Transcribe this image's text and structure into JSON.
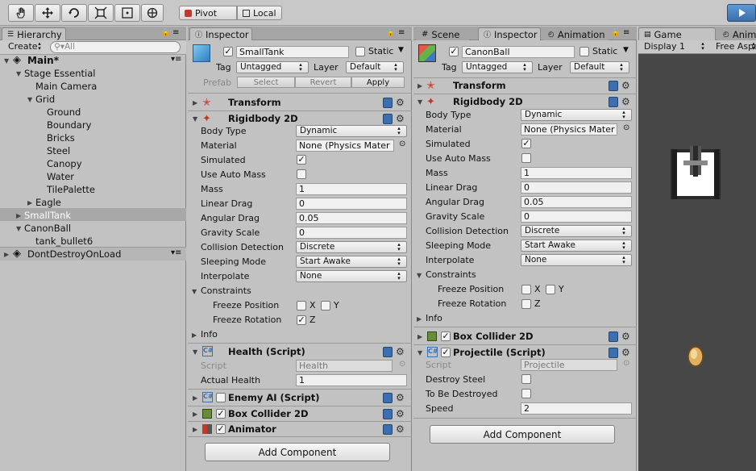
{
  "toolbar": {
    "pivot": "Pivot",
    "local": "Local"
  },
  "hierarchy": {
    "tab": "Hierarchy",
    "create": "Create",
    "search_placeholder": "All",
    "scene": "Main*",
    "items": [
      "Stage Essential",
      "Main Camera",
      "Grid",
      "Ground",
      "Boundary",
      "Bricks",
      "Steel",
      "Canopy",
      "Water",
      "TilePalette",
      "Eagle",
      "SmallTank",
      "CanonBall",
      "tank_bullet6",
      "DontDestroyOnLoad"
    ]
  },
  "inspector1": {
    "tab": "Inspector",
    "name": "SmallTank",
    "static": "Static",
    "tag_label": "Tag",
    "tag": "Untagged",
    "layer_label": "Layer",
    "layer": "Default",
    "prefab": "Prefab",
    "select": "Select",
    "revert": "Revert",
    "apply": "Apply",
    "transform": "Transform",
    "rigidbody": "Rigidbody 2D",
    "props": {
      "body_type": "Body Type",
      "material": "Material",
      "simulated": "Simulated",
      "use_auto_mass": "Use Auto Mass",
      "mass": "Mass",
      "linear_drag": "Linear Drag",
      "angular_drag": "Angular Drag",
      "gravity_scale": "Gravity Scale",
      "collision_detection": "Collision Detection",
      "sleeping_mode": "Sleeping Mode",
      "interpolate": "Interpolate",
      "constraints": "Constraints",
      "freeze_position": "Freeze Position",
      "freeze_rotation": "Freeze Rotation",
      "info": "Info"
    },
    "values": {
      "body_type": "Dynamic",
      "material": "None (Physics Mater",
      "mass": "1",
      "linear_drag": "0",
      "angular_drag": "0.05",
      "gravity_scale": "0",
      "collision_detection": "Discrete",
      "sleeping_mode": "Start Awake",
      "interpolate": "None",
      "x": "X",
      "y": "Y",
      "z": "Z"
    },
    "health": "Health (Script)",
    "script_label": "Script",
    "script_value": "Health",
    "actual_health_label": "Actual Health",
    "actual_health": "1",
    "enemy_ai": "Enemy AI (Script)",
    "box_collider": "Box Collider 2D",
    "animator": "Animator",
    "add_component": "Add Component"
  },
  "inspector2": {
    "tab_scene": "Scene",
    "tab": "Inspector",
    "tab_animation": "Animation",
    "name": "CanonBall",
    "static": "Static",
    "tag_label": "Tag",
    "tag": "Untagged",
    "layer_label": "Layer",
    "layer": "Default",
    "transform": "Transform",
    "rigidbody": "Rigidbody 2D",
    "values": {
      "body_type": "Dynamic",
      "material": "None (Physics Mater",
      "mass": "1",
      "linear_drag": "0",
      "angular_drag": "0.05",
      "gravity_scale": "0",
      "collision_detection": "Discrete",
      "sleeping_mode": "Start Awake",
      "interpolate": "None"
    },
    "box_collider": "Box Collider 2D",
    "projectile": "Projectile (Script)",
    "script_value": "Projectile",
    "destroy_steel": "Destroy Steel",
    "to_be_destroyed": "To Be Destroyed",
    "speed_label": "Speed",
    "speed": "2",
    "add_component": "Add Component"
  },
  "game": {
    "tab": "Game",
    "tab2": "Anim",
    "display": "Display 1",
    "aspect": "Free Aspe"
  },
  "colors": {
    "accent": "#3d6ea8",
    "selected_row": "#a8a8a8",
    "game_bg": "#474747"
  }
}
